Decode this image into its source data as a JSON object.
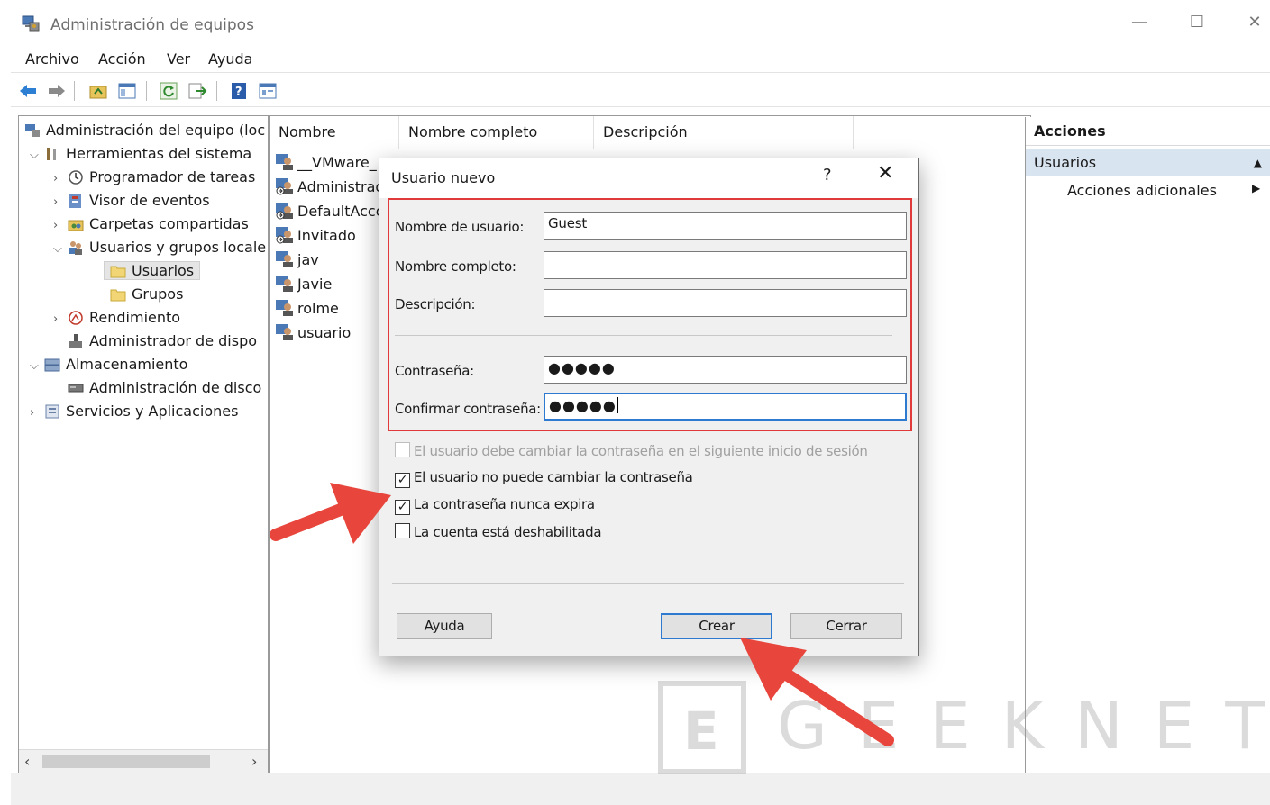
{
  "window": {
    "title": "Administración de equipos",
    "controls": {
      "minimize": "—",
      "maximize": "☐",
      "close": "✕"
    }
  },
  "menubar": {
    "items": [
      "Archivo",
      "Acción",
      "Ver",
      "Ayuda"
    ]
  },
  "toolbar": {
    "icons": [
      "back-arrow-icon",
      "forward-arrow-icon",
      "up-folder-icon",
      "show-hide-tree-icon",
      "refresh-icon",
      "export-list-icon",
      "help-icon",
      "properties-icon"
    ]
  },
  "tree": {
    "root": "Administración del equipo (loc",
    "system_tools": "Herramientas del sistema",
    "task_scheduler": "Programador de tareas",
    "event_viewer": "Visor de eventos",
    "shared_folders": "Carpetas compartidas",
    "local_users_groups": "Usuarios y grupos locale",
    "users": "Usuarios",
    "groups": "Grupos",
    "performance": "Rendimiento",
    "device_manager": "Administrador de dispo",
    "storage": "Almacenamiento",
    "disk_management": "Administración de disco",
    "services_apps": "Servicios y Aplicaciones"
  },
  "list": {
    "columns": [
      "Nombre",
      "Nombre completo",
      "Descripción"
    ],
    "rows": [
      "__VMware_",
      "Administrad",
      "DefaultAcco",
      "Invitado",
      "jav",
      "Javie",
      "rolme",
      "usuario"
    ]
  },
  "actions": {
    "header": "Acciones",
    "section": "Usuarios",
    "item": "Acciones adicionales"
  },
  "dialog": {
    "title": "Usuario nuevo",
    "help": "?",
    "close": "✕",
    "fields": {
      "username_label": "Nombre de usuario:",
      "username_value": "Guest",
      "fullname_label": "Nombre completo:",
      "fullname_value": "",
      "description_label": "Descripción:",
      "description_value": "",
      "password_label": "Contraseña:",
      "password_value": "●●●●●",
      "confirm_label": "Confirmar contraseña:",
      "confirm_value": "●●●●●"
    },
    "checkboxes": {
      "must_change": "El usuario debe cambiar la contraseña en el siguiente inicio de sesión",
      "cannot_change": "El usuario no puede cambiar la contraseña",
      "never_expires": "La contraseña nunca expira",
      "disabled": "La cuenta está deshabilitada"
    },
    "checked": {
      "must_change": false,
      "cannot_change": true,
      "never_expires": true,
      "disabled": false
    },
    "buttons": {
      "help": "Ayuda",
      "create": "Crear",
      "close": "Cerrar"
    }
  },
  "watermark": {
    "logo_letter": "E",
    "text": "GEEKNETIC"
  },
  "colors": {
    "highlight_red": "#e03a3a",
    "arrow_red": "#e8463c",
    "focus_blue": "#2f7ad1",
    "action_section_bg": "#d9e4f1"
  }
}
